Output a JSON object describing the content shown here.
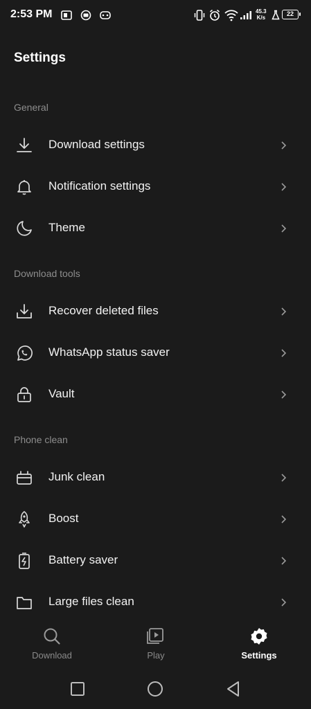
{
  "status_bar": {
    "time": "2:53 PM",
    "net_speed_value": "45.3",
    "net_speed_unit": "K/s",
    "battery": "22"
  },
  "page": {
    "title": "Settings"
  },
  "sections": [
    {
      "header": "General",
      "items": [
        {
          "label": "Download settings",
          "icon": "download-icon"
        },
        {
          "label": "Notification settings",
          "icon": "bell-icon"
        },
        {
          "label": "Theme",
          "icon": "moon-icon"
        }
      ]
    },
    {
      "header": "Download tools",
      "items": [
        {
          "label": "Recover deleted files",
          "icon": "recover-icon"
        },
        {
          "label": "WhatsApp status saver",
          "icon": "whatsapp-icon"
        },
        {
          "label": "Vault",
          "icon": "lock-icon"
        }
      ]
    },
    {
      "header": "Phone clean",
      "items": [
        {
          "label": "Junk clean",
          "icon": "junk-icon"
        },
        {
          "label": "Boost",
          "icon": "rocket-icon"
        },
        {
          "label": "Battery saver",
          "icon": "battery-icon"
        },
        {
          "label": "Large files clean",
          "icon": "folder-icon"
        }
      ]
    }
  ],
  "bottom_nav": [
    {
      "label": "Download",
      "icon": "search-icon",
      "active": false
    },
    {
      "label": "Play",
      "icon": "play-icon",
      "active": false
    },
    {
      "label": "Settings",
      "icon": "gear-icon",
      "active": true
    }
  ],
  "colors": {
    "background": "#1b1b1b",
    "text": "#f2f2f2",
    "muted": "#8d8d8d"
  }
}
